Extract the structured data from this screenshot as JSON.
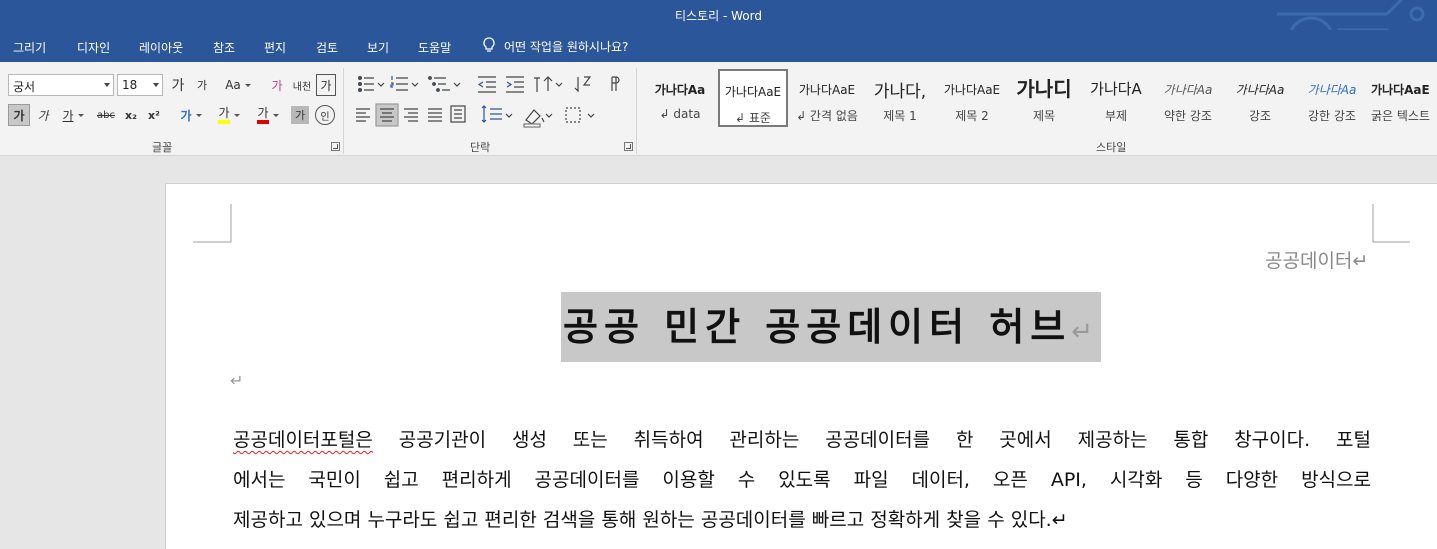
{
  "window": {
    "title": "티스토리  -  Word"
  },
  "menu": {
    "tabs": [
      "그리기",
      "디자인",
      "레이아웃",
      "참조",
      "편지",
      "검토",
      "보기",
      "도움말"
    ],
    "tell_me": "어떤 작업을 원하시나요?"
  },
  "font_group": {
    "label": "글꼴",
    "font_name": "궁서",
    "font_size": "18",
    "grow": "가",
    "shrink": "가",
    "case": "Aa",
    "clear": "가",
    "phonetic": "내천",
    "border_char": "가",
    "bold": "가",
    "italic": "가",
    "underline": "가",
    "strike": "abc",
    "subscript": "x₂",
    "superscript": "x²",
    "effects": "가",
    "highlight": "가",
    "font_color": "가",
    "shading": "가",
    "enclose": "인",
    "highlight_color": "#ffff00",
    "font_color_value": "#e00000"
  },
  "paragraph_group": {
    "label": "단락"
  },
  "styles_group": {
    "label": "스타일",
    "items": [
      {
        "sample": "가나다Aa",
        "name": "↲ data"
      },
      {
        "sample": "가나다AaE",
        "name": "↲ 표준"
      },
      {
        "sample": "가나다AaE",
        "name": "↲ 간격 없음"
      },
      {
        "sample": "가나다,",
        "name": "제목 1"
      },
      {
        "sample": "가나다AaE",
        "name": "제목 2"
      },
      {
        "sample": "가나디",
        "name": "제목"
      },
      {
        "sample": "가나다A",
        "name": "부제"
      },
      {
        "sample": "가나다Aa",
        "name": "약한 강조"
      },
      {
        "sample": "가나다Aa",
        "name": "강조"
      },
      {
        "sample": "가나다Aa",
        "name": "강한 강조"
      },
      {
        "sample": "가나다AaE",
        "name": "굵은 텍스트"
      }
    ]
  },
  "document": {
    "header_text": "공공데이터↵",
    "title": "공공 민간 공공데이터 허브",
    "title_mark": "↵",
    "empty_mark": "↵",
    "body_first_word": "공공데이터포털은",
    "body_line1_rest": " 공공기관이 생성 또는 취득하여 관리하는 공공데이터를 한 곳에서 제공하는 통합 창구이다. 포털",
    "body_line2": "에서는 국민이 쉽고 편리하게 공공데이터를 이용할 수 있도록 파일 데이터, 오픈 API, 시각화 등 다양한 방식으로",
    "body_line3": "제공하고 있으며 누구라도 쉽고 편리한 검색을 통해 원하는 공공데이터를 빠르고 정확하게 찾을 수 있다.↵"
  }
}
